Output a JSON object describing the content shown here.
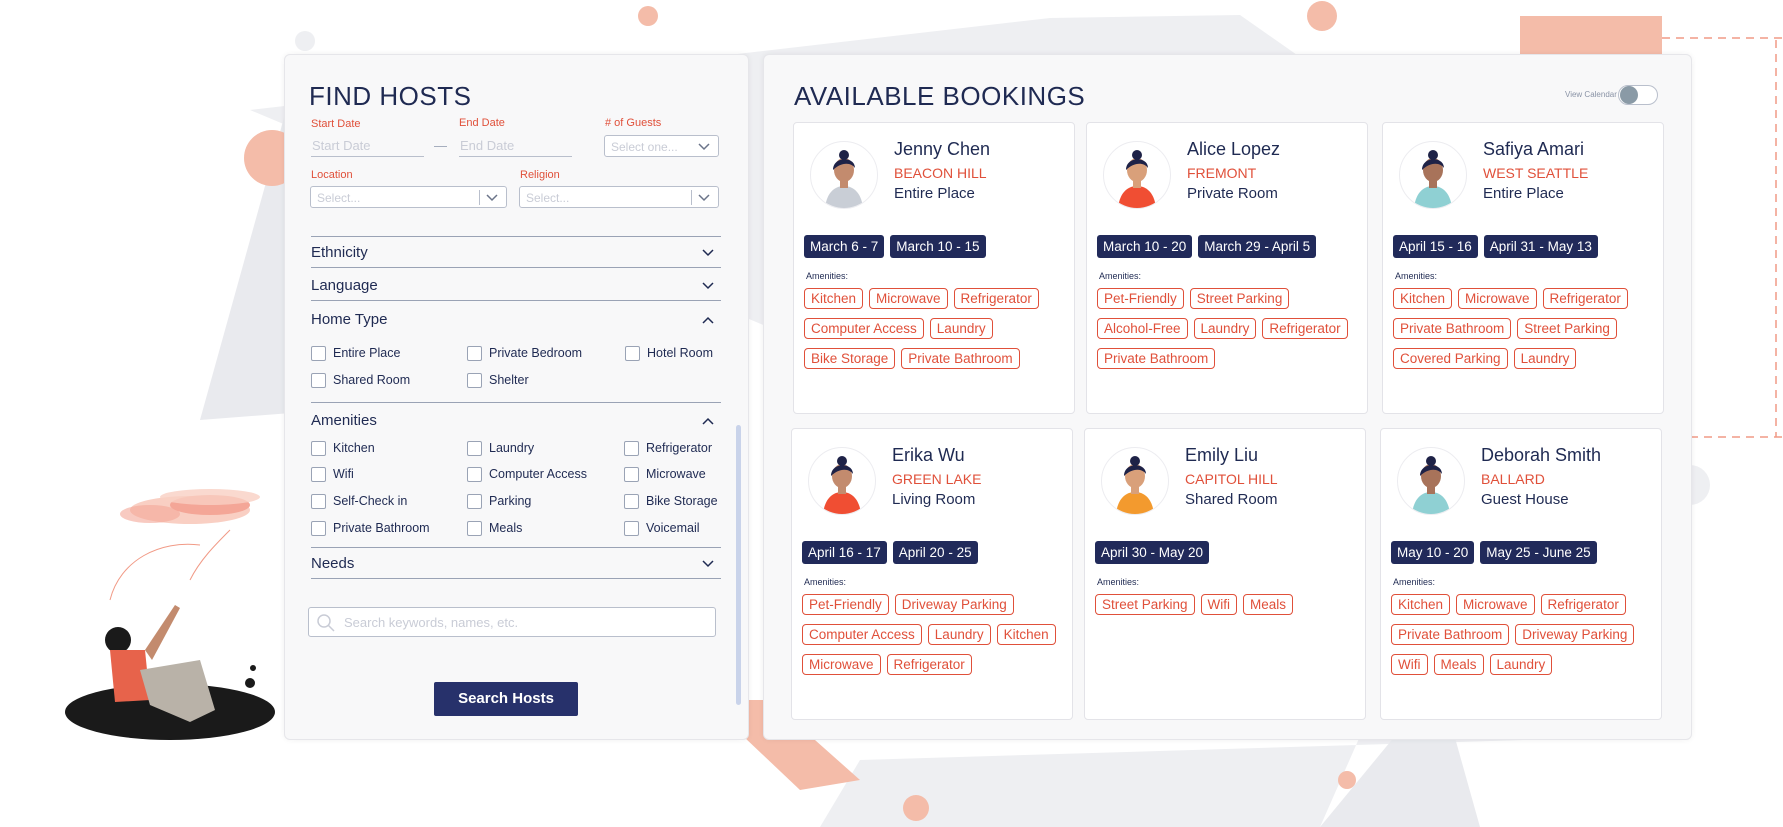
{
  "find_hosts": {
    "title": "FIND HOSTS",
    "start_date_label": "Start Date",
    "start_date_placeholder": "Start Date",
    "date_separator": "—",
    "end_date_label": "End Date",
    "end_date_placeholder": "End Date",
    "guests_label": "# of Guests",
    "guests_placeholder": "Select one...",
    "location_label": "Location",
    "location_placeholder": "Select...",
    "religion_label": "Religion",
    "religion_placeholder": "Select...",
    "sections": {
      "ethnicity": "Ethnicity",
      "language": "Language",
      "home_type": "Home Type",
      "amenities": "Amenities",
      "needs": "Needs"
    },
    "home_types": [
      "Entire Place",
      "Private Bedroom",
      "Hotel Room",
      "Shared Room",
      "Shelter"
    ],
    "amenities": [
      "Kitchen",
      "Laundry",
      "Refrigerator",
      "Wifi",
      "Computer Access",
      "Microwave",
      "Self-Check in",
      "Parking",
      "Bike Storage",
      "Private Bathroom",
      "Meals",
      "Voicemail"
    ],
    "search_placeholder": "Search keywords, names, etc.",
    "search_button": "Search Hosts"
  },
  "bookings": {
    "title": "AVAILABLE BOOKINGS",
    "view_calendar_label": "View Calendar",
    "amenities_label": "Amenities:",
    "cards": [
      {
        "name": "Jenny Chen",
        "neighborhood": "BEACON HILL",
        "home_type": "Entire Place",
        "dates": [
          "March 6 - 7",
          "March 10 - 15"
        ],
        "amenities": [
          "Kitchen",
          "Microwave",
          "Refrigerator",
          "Computer Access",
          "Laundry",
          "Bike Storage",
          "Private Bathroom"
        ]
      },
      {
        "name": "Alice Lopez",
        "neighborhood": "FREMONT",
        "home_type": "Private Room",
        "dates": [
          "March 10 - 20",
          "March 29 - April 5"
        ],
        "amenities": [
          "Pet-Friendly",
          "Street Parking",
          "Alcohol-Free",
          "Laundry",
          "Refrigerator",
          "Private Bathroom"
        ]
      },
      {
        "name": "Safiya Amari",
        "neighborhood": "WEST SEATTLE",
        "home_type": "Entire Place",
        "dates": [
          "April 15 - 16",
          "April 31 - May 13"
        ],
        "amenities": [
          "Kitchen",
          "Microwave",
          "Refrigerator",
          "Private Bathroom",
          "Street Parking",
          "Covered Parking",
          "Laundry"
        ]
      },
      {
        "name": "Erika Wu",
        "neighborhood": "GREEN LAKE",
        "home_type": "Living Room",
        "dates": [
          "April 16 - 17",
          "April 20 - 25"
        ],
        "amenities": [
          "Pet-Friendly",
          "Driveway Parking",
          "Computer Access",
          "Laundry",
          "Kitchen",
          "Microwave",
          "Refrigerator"
        ]
      },
      {
        "name": "Emily Liu",
        "neighborhood": "CAPITOL HILL",
        "home_type": "Shared Room",
        "dates": [
          "April 30 -  May 20"
        ],
        "amenities": [
          "Street Parking",
          "Wifi",
          "Meals"
        ]
      },
      {
        "name": "Deborah Smith",
        "neighborhood": "BALLARD",
        "home_type": "Guest House",
        "dates": [
          "May 10 - 20",
          "May 25 - June 25"
        ],
        "amenities": [
          "Kitchen",
          "Microwave",
          "Refrigerator",
          "Private Bathroom",
          "Driveway Parking",
          "Wifi",
          "Meals",
          "Laundry"
        ]
      }
    ]
  },
  "colors": {
    "navy": "#212a5a",
    "accent_red": "#e0503a",
    "peach": "#f4bca9",
    "panel_bg": "#f8f8f9"
  },
  "icons": [
    "chevron-down-icon",
    "chevron-up-icon",
    "search-icon",
    "avatar-icon"
  ]
}
